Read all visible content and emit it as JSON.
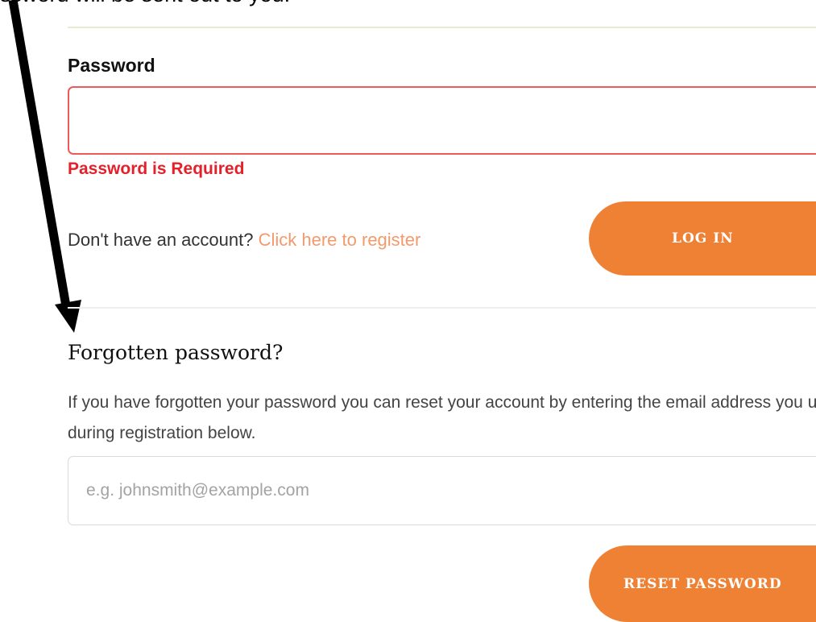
{
  "annotation": {
    "caption": "ssword will be sent out to you."
  },
  "login": {
    "password_label": "Password",
    "password_value": "",
    "password_error": "Password is Required",
    "register_prompt": "Don't have an account?",
    "register_link": "Click here to register",
    "login_button": "LOG IN"
  },
  "forgot": {
    "heading": "Forgotten password?",
    "description": "If you have forgotten your password you can reset your account by entering the email address you used during registration below.",
    "email_placeholder": "e.g. johnsmith@example.com",
    "email_value": "",
    "reset_button": "RESET PASSWORD"
  },
  "colors": {
    "accent": "#ef8134",
    "error": "#e5202b",
    "link": "#f39a6d"
  }
}
